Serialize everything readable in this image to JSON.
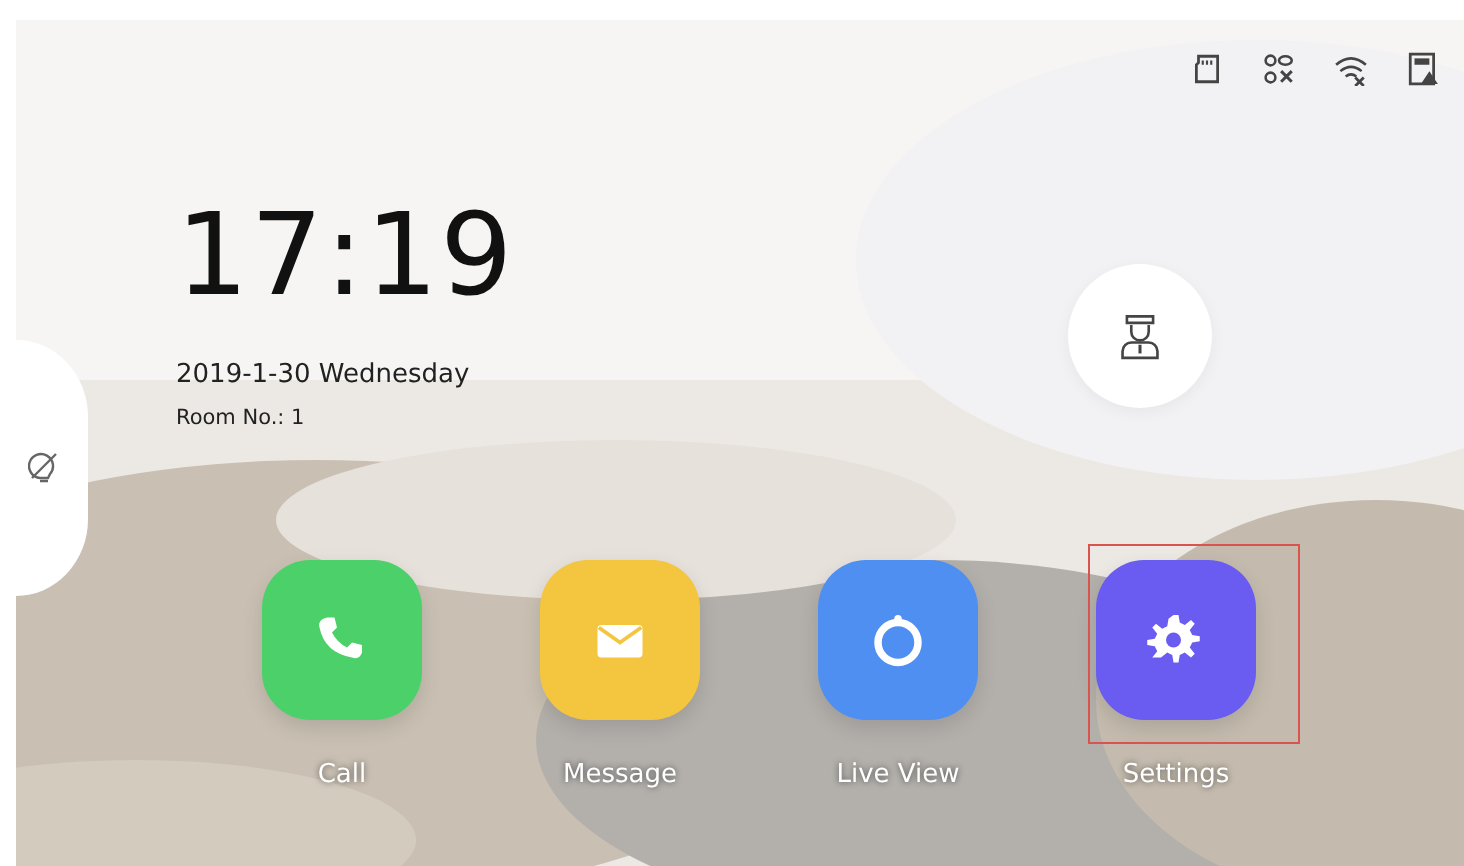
{
  "status_icons": [
    {
      "kind": "sd"
    },
    {
      "kind": "link-off"
    },
    {
      "kind": "wifi-off"
    },
    {
      "kind": "alarm"
    }
  ],
  "clock": {
    "time": "17:19",
    "date": "2019-1-30  Wednesday",
    "room": "Room No.: 1"
  },
  "apps": [
    {
      "kind": "call",
      "label": "Call",
      "color": "#4cd06a",
      "highlighted": false
    },
    {
      "kind": "message",
      "label": "Message",
      "color": "#f4c53e",
      "highlighted": false
    },
    {
      "kind": "live",
      "label": "Live View",
      "color": "#4f8ff2",
      "highlighted": false
    },
    {
      "kind": "settings",
      "label": "Settings",
      "color": "#6a5cf0",
      "highlighted": true
    }
  ]
}
